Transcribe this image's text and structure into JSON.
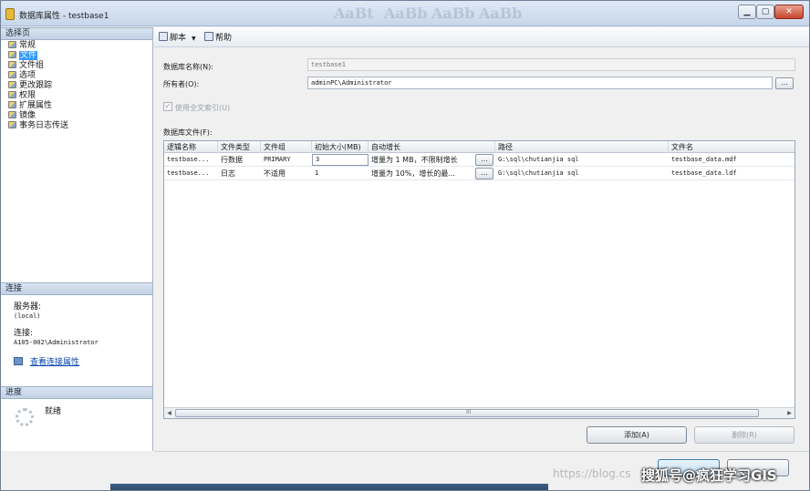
{
  "window": {
    "title": "数据库属性 - testbase1",
    "ghost_toolbar": [
      "AaBt",
      "AaBb",
      "AaBb",
      "AaBb"
    ],
    "controls": {
      "minimize": "▁",
      "maximize": "▢",
      "close": "✕"
    }
  },
  "sidebar": {
    "select_page_header": "选择页",
    "items": [
      {
        "label": "常规",
        "selected": false
      },
      {
        "label": "文件",
        "selected": true
      },
      {
        "label": "文件组",
        "selected": false
      },
      {
        "label": "选项",
        "selected": false
      },
      {
        "label": "更改跟踪",
        "selected": false
      },
      {
        "label": "权限",
        "selected": false
      },
      {
        "label": "扩展属性",
        "selected": false
      },
      {
        "label": "镜像",
        "selected": false
      },
      {
        "label": "事务日志传送",
        "selected": false
      }
    ],
    "connection": {
      "header": "连接",
      "server_label": "服务器:",
      "server_value": "(local)",
      "connection_label": "连接:",
      "connection_value": "A105-002\\Administrator",
      "view_link": "查看连接属性"
    },
    "progress": {
      "header": "进度",
      "status": "就绪"
    }
  },
  "toolbar": {
    "script_label": "脚本",
    "help_label": "帮助"
  },
  "form": {
    "db_name_label": "数据库名称(N):",
    "db_name_value": "testbase1",
    "owner_label": "所有者(O):",
    "owner_value": "adminPC\\Administrator",
    "owner_browse": "...",
    "fulltext_label": "使用全文索引(U)",
    "db_files_label": "数据库文件(F):"
  },
  "grid": {
    "columns": [
      "逻辑名称",
      "文件类型",
      "文件组",
      "初始大小(MB)",
      "自动增长",
      "路径",
      "文件名"
    ],
    "rows": [
      {
        "logical_name": "testbase...",
        "file_type": "行数据",
        "filegroup": "PRIMARY",
        "initial_size": "3",
        "autogrowth": "增量为 1 MB，不限制增长",
        "growth_btn": "...",
        "path": "G:\\sql\\chutianjia sql",
        "file_name": "testbase_data.mdf"
      },
      {
        "logical_name": "testbase...",
        "file_type": "日志",
        "filegroup": "不适用",
        "initial_size": "1",
        "autogrowth": "增量为 10%，增长的最...",
        "growth_btn": "...",
        "path": "G:\\sql\\chutianjia sql",
        "file_name": "testbase_data.ldf"
      }
    ],
    "scroll_left": "◀",
    "scroll_right": "▶",
    "scroll_grip": "III"
  },
  "buttons": {
    "add": "添加(A)",
    "remove": "删除(R)"
  },
  "watermarks": {
    "url": "https://blog.cs",
    "brand": "搜狐号@疯狂学习GIS"
  },
  "colors": {
    "selection": "#3399ff",
    "link": "#0645ad",
    "section_header": "#c2d1e5"
  }
}
